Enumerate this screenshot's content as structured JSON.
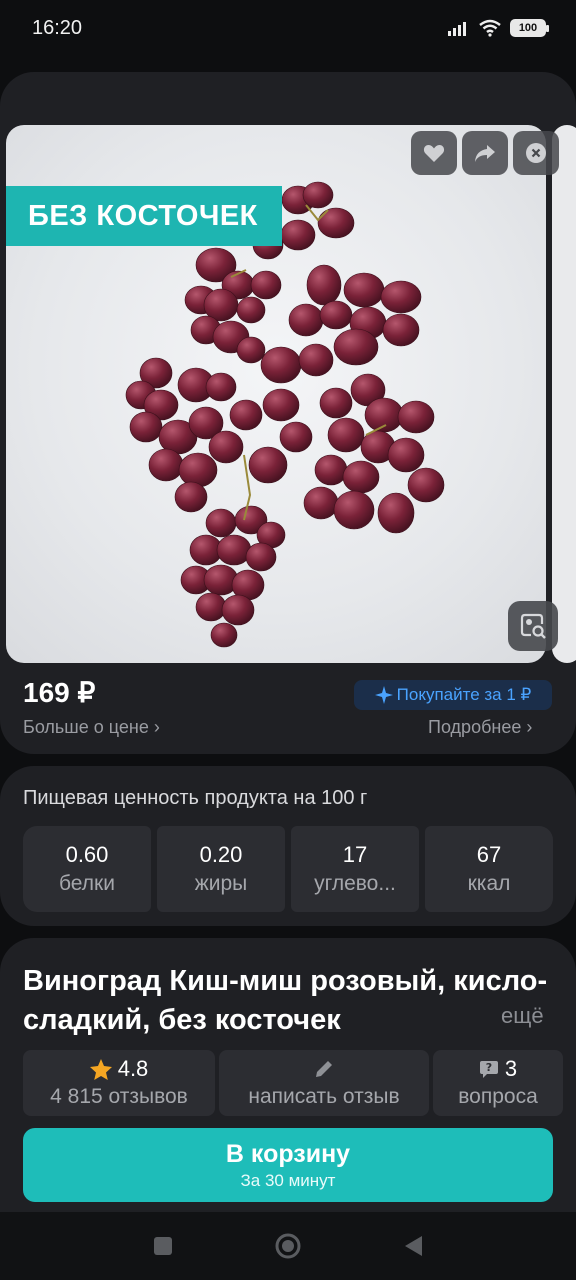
{
  "status_bar": {
    "time": "16:20",
    "battery": "100"
  },
  "product": {
    "badge": "БЕЗ КОСТОЧЕК",
    "price": "169 ₽",
    "promo": "Покупайте за 1 ₽",
    "price_link": "Больше о цене",
    "details_link": "Подробнее",
    "title": "Виноград Киш-миш розовый, кисло-сладкий, без косточек",
    "more": "ещё"
  },
  "nutrition": {
    "title": "Пищевая ценность продукта на 100 г",
    "items": [
      {
        "value": "0.60",
        "label": "белки"
      },
      {
        "value": "0.20",
        "label": "жиры"
      },
      {
        "value": "17",
        "label": "углево..."
      },
      {
        "value": "67",
        "label": "ккал"
      }
    ]
  },
  "reviews": {
    "rating": "4.8",
    "count": "4 815 отзывов",
    "write": "написать отзыв",
    "questions_count": "3",
    "questions_label": "вопроса"
  },
  "cart": {
    "label": "В корзину",
    "sub": "За 30 минут"
  },
  "colors": {
    "accent": "#1ebdb9",
    "promo_blue": "#4aa3ff",
    "star": "#f5a623"
  },
  "icons": [
    "heart-icon",
    "share-icon",
    "close-icon",
    "visual-search-icon",
    "star-icon",
    "pencil-icon",
    "question-icon",
    "sparkle-icon",
    "chevron-right-icon"
  ]
}
